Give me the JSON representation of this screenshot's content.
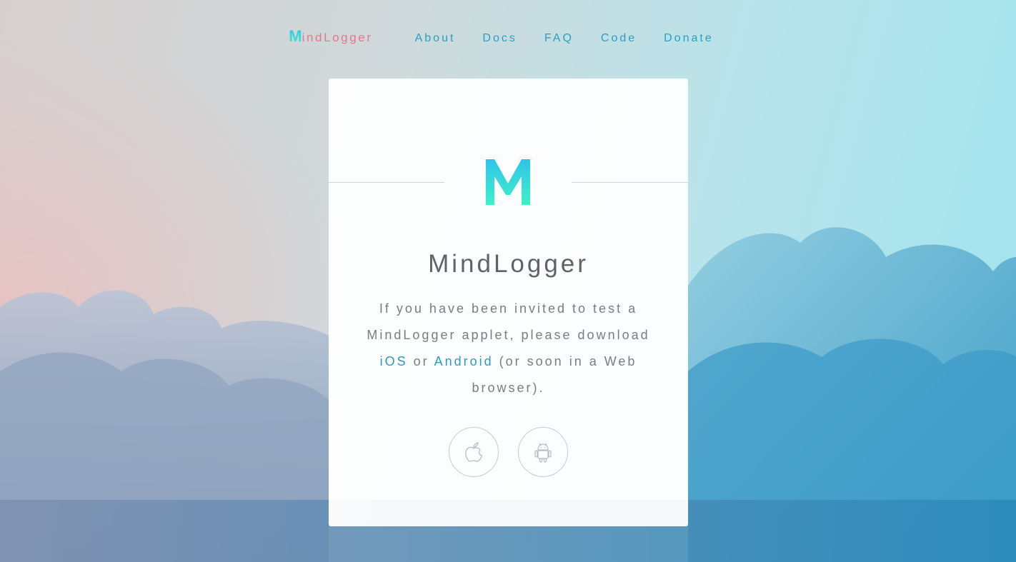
{
  "nav": {
    "brand_initial": "M",
    "brand_rest": "indLogger",
    "links": [
      "About",
      "Docs",
      "FAQ",
      "Code",
      "Donate"
    ]
  },
  "card": {
    "logo_letter": "M",
    "title": "MindLogger",
    "text_1": "If you have been invited to test a MindLogger applet, please download ",
    "ios_link": "iOS",
    "text_2": " or ",
    "android_link": "Android",
    "text_3": " (or soon in a Web browser).",
    "icons": {
      "ios": "apple-icon",
      "android": "android-icon"
    }
  },
  "colors": {
    "brand_gradient_top": "#2fc7e8",
    "brand_gradient_bottom": "#3fe6c8",
    "brand_pink": "#e7768f",
    "link": "#2aa0bf",
    "text": "#7a7d80"
  }
}
